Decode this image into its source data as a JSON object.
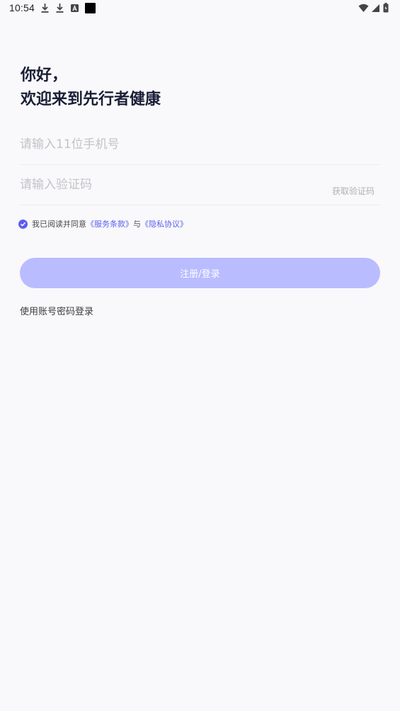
{
  "status_bar": {
    "time": "10:54",
    "left_icons": [
      "download-icon",
      "download-icon",
      "a-letter-icon",
      "black-square-icon"
    ],
    "right_icons": [
      "wifi-icon",
      "signal-icon",
      "battery-icon"
    ]
  },
  "greeting": {
    "line1": "你好，",
    "line2": "欢迎来到先行者健康"
  },
  "phone_field": {
    "placeholder": "请输入11位手机号",
    "value": ""
  },
  "code_field": {
    "placeholder": "请输入验证码",
    "value": "",
    "get_code_label": "获取验证码"
  },
  "agreement": {
    "checked": true,
    "prefix": "我已阅读并同意",
    "terms_link": "《服务条款》",
    "connector": "与",
    "privacy_link": "《隐私协议》"
  },
  "login_button": {
    "label": "注册/登录"
  },
  "alt_login": {
    "label": "使用账号密码登录"
  },
  "colors": {
    "accent": "#5a5ff0",
    "button_disabled": "#b9bcff",
    "background": "#f9f9fb",
    "title": "#1a1f36"
  }
}
